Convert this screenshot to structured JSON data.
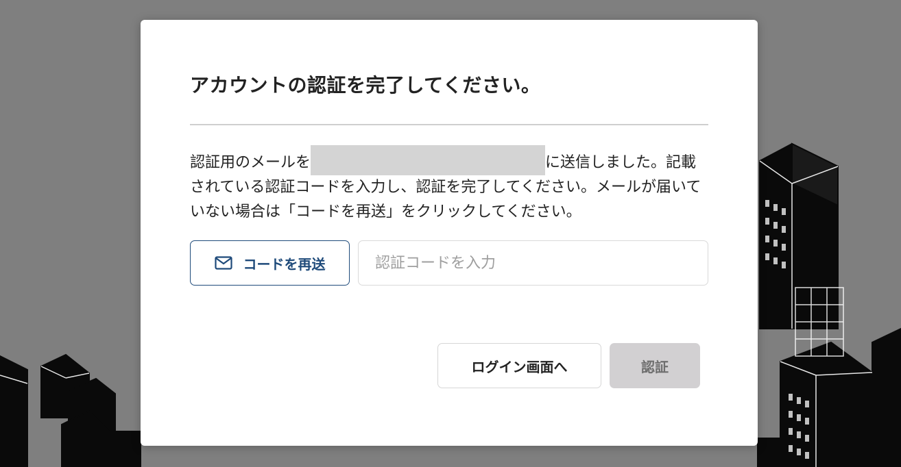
{
  "dialog": {
    "title": "アカウントの認証を完了してください。",
    "message_before": "認証用のメールを",
    "message_after": "に送信しました。記載されている認証コードを入力し、認証を完了してください。メールが届いていない場合は「コードを再送」をクリックしてください。",
    "resend_label": "コードを再送",
    "code_placeholder": "認証コードを入力",
    "back_label": "ログイン画面へ",
    "verify_label": "認証"
  },
  "icons": {
    "resend": "mail-icon"
  },
  "colors": {
    "overlay": "#7f7f7f",
    "accent": "#1e4a7a",
    "disabled_button": "#d2d0d2"
  }
}
